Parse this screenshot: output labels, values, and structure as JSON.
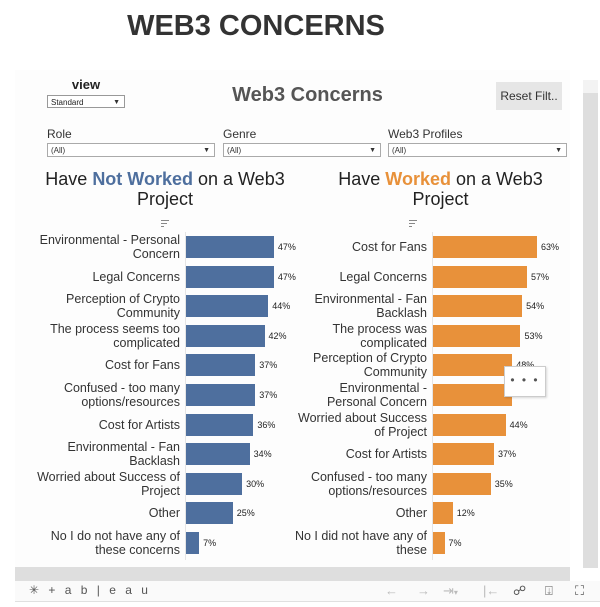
{
  "page_title": "WEB3 CONCERNS",
  "dashboard": {
    "title": "Web3 Concerns",
    "view_label": "view",
    "view_select": "Standard",
    "reset_button": "Reset Filt..",
    "filters": [
      {
        "label": "Role",
        "value": "(All)"
      },
      {
        "label": "Genre",
        "value": "(All)"
      },
      {
        "label": "Web3 Profiles",
        "value": "(All)"
      }
    ],
    "more_menu": "• • •"
  },
  "colors": {
    "not_worked": "#4e6f9e",
    "worked": "#e8913a"
  },
  "chart_data": [
    {
      "type": "bar",
      "orientation": "horizontal",
      "title_parts": [
        "Have ",
        "Not Worked",
        " on a Web3 Project"
      ],
      "title": "Have Not Worked on a Web3 Project",
      "categories": [
        "Environmental - Personal Concern",
        "Legal Concerns",
        "Perception of Crypto Community",
        "The process seems too complicated",
        "Cost for Fans",
        "Confused - too many options/resources",
        "Cost for Artists",
        "Environmental - Fan Backlash",
        "Worried about Success of Project",
        "Other",
        "No I do not have any of these concerns"
      ],
      "values": [
        47,
        47,
        44,
        42,
        37,
        37,
        36,
        34,
        30,
        25,
        7
      ],
      "labels": [
        "47%",
        "47%",
        "44%",
        "42%",
        "37%",
        "37%",
        "36%",
        "34%",
        "30%",
        "25%",
        "7%"
      ],
      "unit": "%",
      "xlim": [
        0,
        50
      ],
      "grid": false,
      "legend": "none"
    },
    {
      "type": "bar",
      "orientation": "horizontal",
      "title_parts": [
        "Have ",
        "Worked",
        " on a Web3 Project"
      ],
      "title": "Have Worked on a Web3 Project",
      "categories": [
        "Cost for Fans",
        "Legal Concerns",
        "Environmental - Fan Backlash",
        "The process was complicated",
        "Perception of Crypto Community",
        "Environmental - Personal Concern",
        "Worried about Success of Project",
        "Cost for Artists",
        "Confused - too many options/resources",
        "Other",
        "No I did not have any of these"
      ],
      "values": [
        63,
        57,
        54,
        53,
        48,
        48,
        44,
        37,
        35,
        12,
        7
      ],
      "labels": [
        "63%",
        "57%",
        "54%",
        "53%",
        "48%",
        "",
        "44%",
        "37%",
        "35%",
        "12%",
        "7%"
      ],
      "unit": "%",
      "xlim": [
        0,
        70
      ],
      "grid": false,
      "legend": "none"
    }
  ],
  "toolbar": {
    "logo": "+ a b | e a u",
    "icons": [
      "undo-icon",
      "redo-icon",
      "revert-icon",
      "reset-start-icon",
      "share-icon",
      "download-icon",
      "fullscreen-icon"
    ]
  }
}
